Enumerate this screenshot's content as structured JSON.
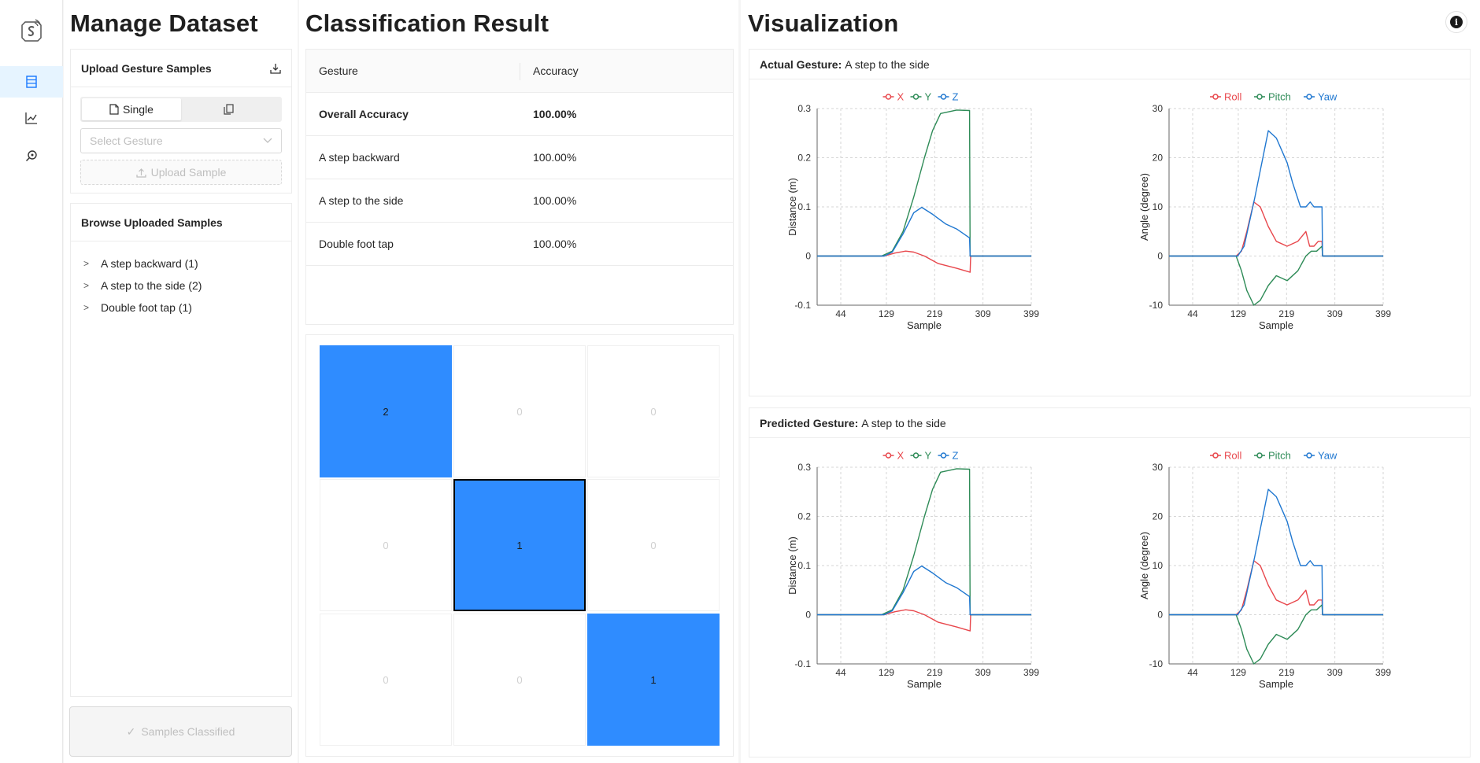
{
  "colors": {
    "accent": "#1677ff",
    "cell_on": "#2f8cff",
    "x": "#e8474c",
    "y": "#2e8b57",
    "z": "#1f77d0"
  },
  "rail": {
    "items": [
      "dataset-icon",
      "chart-icon",
      "search-icon"
    ]
  },
  "dataset": {
    "title": "Manage Dataset",
    "upload": {
      "heading": "Upload Gesture Samples",
      "mode_single": "Single",
      "select_placeholder": "Select Gesture",
      "upload_label": "Upload Sample"
    },
    "browse": {
      "heading": "Browse Uploaded Samples",
      "items": [
        "A step backward (1)",
        "A step to the side (2)",
        "Double foot tap (1)"
      ]
    },
    "classified_label": "Samples Classified"
  },
  "classification": {
    "title": "Classification Result",
    "headers": [
      "Gesture",
      "Accuracy"
    ],
    "rows": [
      {
        "gesture": "Overall Accuracy",
        "accuracy": "100.00%"
      },
      {
        "gesture": "A step backward",
        "accuracy": "100.00%"
      },
      {
        "gesture": "A step to the side",
        "accuracy": "100.00%"
      },
      {
        "gesture": "Double foot tap",
        "accuracy": "100.00%"
      }
    ],
    "confusion": [
      [
        "2",
        "0",
        "0"
      ],
      [
        "0",
        "1",
        "0"
      ],
      [
        "0",
        "0",
        "1"
      ]
    ]
  },
  "visualization": {
    "title": "Visualization",
    "actual_label": "Actual Gesture:",
    "actual_value": "A step to the side",
    "predicted_label": "Predicted Gesture:",
    "predicted_value": "A step to the side"
  },
  "chart_data": [
    {
      "type": "line",
      "xlabel": "Sample",
      "ylabel": "Distance (m)",
      "xticks": [
        44,
        129,
        219,
        309,
        399
      ],
      "xlim": [
        0,
        399
      ],
      "ylim": [
        -0.1,
        0.3
      ],
      "yticks": [
        -0.1,
        0,
        0.1,
        0.2,
        0.3
      ],
      "grid": true,
      "legend": "top",
      "series": [
        {
          "name": "X",
          "x": [
            0,
            125,
            145,
            165,
            180,
            200,
            225,
            260,
            285,
            286,
            399
          ],
          "y": [
            0,
            0,
            0.006,
            0.01,
            0.008,
            0,
            -0.015,
            -0.025,
            -0.033,
            0,
            0
          ]
        },
        {
          "name": "Y",
          "x": [
            0,
            120,
            140,
            160,
            180,
            200,
            215,
            230,
            260,
            284,
            285,
            399
          ],
          "y": [
            0,
            0,
            0.01,
            0.05,
            0.12,
            0.2,
            0.255,
            0.29,
            0.297,
            0.296,
            0,
            0
          ]
        },
        {
          "name": "Z",
          "x": [
            0,
            125,
            140,
            160,
            180,
            195,
            215,
            240,
            260,
            284,
            285,
            399
          ],
          "y": [
            0,
            0,
            0.008,
            0.045,
            0.088,
            0.099,
            0.085,
            0.065,
            0.055,
            0.037,
            0,
            0
          ]
        }
      ]
    },
    {
      "type": "line",
      "xlabel": "Sample",
      "ylabel": "Angle (degree)",
      "xticks": [
        44,
        129,
        219,
        309,
        399
      ],
      "xlim": [
        0,
        399
      ],
      "ylim": [
        -10,
        30
      ],
      "yticks": [
        -10,
        0,
        10,
        20,
        30
      ],
      "grid": true,
      "legend": "top",
      "series": [
        {
          "name": "Roll",
          "x": [
            0,
            125,
            135,
            145,
            158,
            170,
            185,
            200,
            220,
            240,
            255,
            262,
            270,
            278,
            285,
            286,
            399
          ],
          "y": [
            0,
            0,
            1,
            5,
            11,
            10,
            6,
            3,
            2,
            3,
            5,
            2,
            2,
            3,
            3,
            0,
            0
          ]
        },
        {
          "name": "Pitch",
          "x": [
            0,
            125,
            135,
            145,
            158,
            170,
            185,
            200,
            220,
            240,
            255,
            265,
            275,
            285,
            286,
            399
          ],
          "y": [
            0,
            0,
            -3,
            -7,
            -10,
            -9,
            -6,
            -4,
            -5,
            -3,
            0,
            1,
            1,
            2,
            0,
            0
          ]
        },
        {
          "name": "Yaw",
          "x": [
            0,
            128,
            140,
            160,
            185,
            200,
            220,
            230,
            245,
            255,
            263,
            270,
            280,
            285,
            286,
            399
          ],
          "y": [
            0,
            0,
            2,
            12,
            25.5,
            24,
            19,
            15,
            10,
            10,
            11,
            10,
            10,
            10,
            0,
            0
          ]
        }
      ]
    }
  ]
}
